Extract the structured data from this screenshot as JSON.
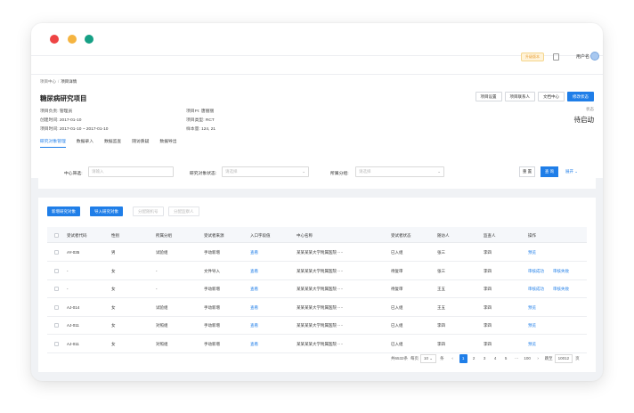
{
  "topbar": {
    "upgrade": "升级版本",
    "username": "用户名"
  },
  "breadcrumb": [
    "项目中心",
    "项目详情"
  ],
  "project": {
    "title": "糖尿病研究项目",
    "buttons": [
      "项目设置",
      "项目联系人",
      "文档中心",
      "修改状态"
    ],
    "info_left": [
      {
        "k": "项目负责:",
        "v": "管理员"
      },
      {
        "k": "创建时间:",
        "v": "2017-01-10"
      },
      {
        "k": "项目时间:",
        "v": "2017-01-10 ~ 2017-01-10"
      }
    ],
    "info_right": [
      {
        "k": "项目PI:",
        "v": "唐丽丽"
      },
      {
        "k": "项目类型:",
        "v": "RCT"
      },
      {
        "k": "样本量:",
        "v": "124, 21"
      }
    ],
    "status_label": "状态",
    "status_value": "待启动",
    "tabs": [
      "研究对象管理",
      "数据录入",
      "数据监查",
      "随访质疑",
      "数据导出"
    ]
  },
  "filters": {
    "center_label": "中心筛选:",
    "center_ph": "请输入",
    "status_label": "研究对象状态:",
    "status_ph": "请选择",
    "group_label": "所属分组:",
    "group_ph": "请选择",
    "reset": "重 置",
    "query": "查 询",
    "expand": "展开"
  },
  "actions": [
    "新增研究对象",
    "导入研究对象",
    "分配随机号",
    "分配监察人"
  ],
  "table": {
    "headers": [
      "受试者代码",
      "性别",
      "所属分组",
      "受试者来源",
      "入口字段值",
      "中心名称",
      "受试者状态",
      "随访人",
      "监查人",
      "操作"
    ],
    "rows": [
      {
        "code": "AY-035",
        "sex": "男",
        "group": "试验组",
        "source": "手动新增",
        "field": "查看",
        "center": "某某某某大学附属医院·····",
        "status": "已入组",
        "follow": "张三",
        "monitor": "李四",
        "ops": [
          "预览"
        ]
      },
      {
        "code": "-",
        "sex": "女",
        "group": "-",
        "source": "文件导入",
        "field": "查看",
        "center": "某某某某大学附属医院·····",
        "status": "待复审",
        "follow": "张三",
        "monitor": "李四",
        "ops": [
          "审核成功",
          "审核失败"
        ]
      },
      {
        "code": "-",
        "sex": "女",
        "group": "-",
        "source": "手动新增",
        "field": "查看",
        "center": "某某某某大学附属医院·····",
        "status": "待复审",
        "follow": "王五",
        "monitor": "李四",
        "ops": [
          "审核成功",
          "审核失败"
        ]
      },
      {
        "code": "AJ-014",
        "sex": "女",
        "group": "试验组",
        "source": "手动新增",
        "field": "查看",
        "center": "某某某某大学附属医院·····",
        "status": "已入组",
        "follow": "王五",
        "monitor": "李四",
        "ops": [
          "预览"
        ]
      },
      {
        "code": "AJ-011",
        "sex": "女",
        "group": "对照组",
        "source": "手动新增",
        "field": "查看",
        "center": "某某某某大学附属医院·····",
        "status": "已入组",
        "follow": "李四",
        "monitor": "李四",
        "ops": [
          "预览"
        ]
      },
      {
        "code": "AJ-011",
        "sex": "女",
        "group": "对照组",
        "source": "手动新增",
        "field": "查看",
        "center": "某某某某大学附属医院·····",
        "status": "已入组",
        "follow": "李四",
        "monitor": "李四",
        "ops": [
          "预览"
        ]
      }
    ]
  },
  "pagination": {
    "total": "共6532条",
    "per_page_label": "每页",
    "per_page": "10",
    "unit": "条",
    "pages": [
      "1",
      "2",
      "3",
      "4",
      "5",
      "···",
      "100"
    ],
    "goto_label": "跳至",
    "goto_value": "10012",
    "goto_unit": "页"
  }
}
